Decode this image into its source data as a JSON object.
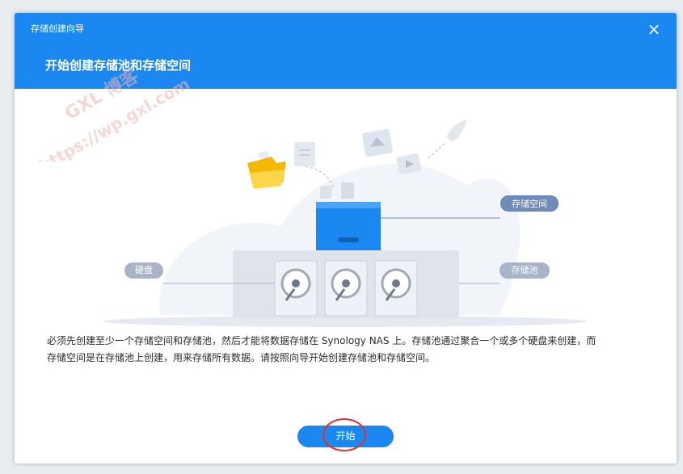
{
  "dialog": {
    "wizard_title": "存储创建向导",
    "step_title": "开始创建存储池和存储空间",
    "close_glyph": "×"
  },
  "illustration": {
    "label_storage_space": "存储空间",
    "label_storage_pool": "存储池",
    "label_hard_disk": "硬盘"
  },
  "description": {
    "line1": "必须先创建至少一个存储空间和存储池，然后才能将数据存储在 Synology NAS 上。存储池通过聚合一个或多个硬盘来创建，而",
    "line2": "存储空间是在存储池上创建，用来存储所有数据。请按照向导开始创建存储池和存储空间。"
  },
  "footer": {
    "start_label": "开始"
  },
  "watermark": {
    "line1": "GXL 博客",
    "line2": "https://wp.gxl.com"
  },
  "colors": {
    "header_blue": "#1b87f0",
    "annotation_red": "#e0302c"
  }
}
